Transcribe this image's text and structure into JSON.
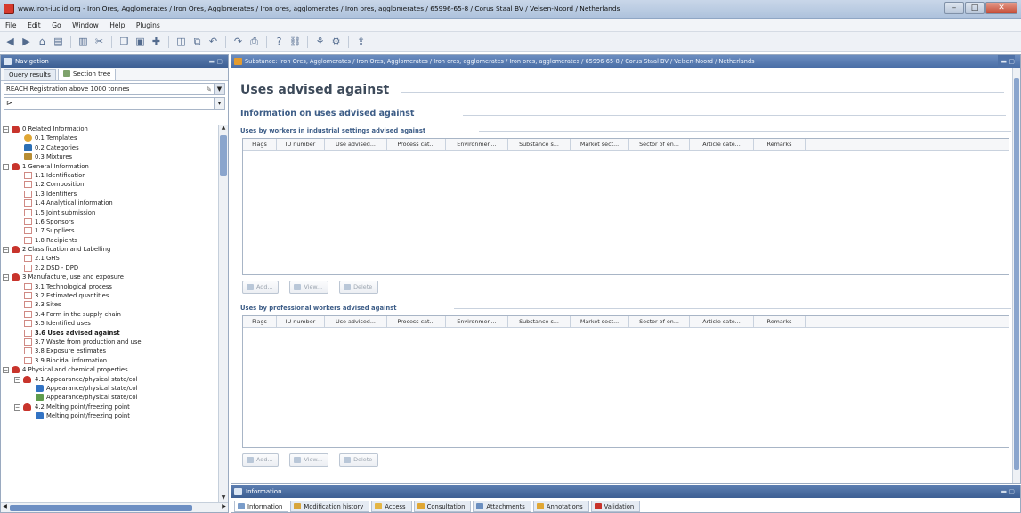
{
  "window": {
    "title": "www.iron-iuclid.org - Iron Ores, Agglomerates / Iron Ores, Agglomerates / Iron ores, agglomerates  / Iron ores, agglomerates  / 65996-65-8 / Corus Staal BV / Velsen-Noord / Netherlands"
  },
  "menu": [
    "File",
    "Edit",
    "Go",
    "Window",
    "Help",
    "Plugins"
  ],
  "toolbar": {
    "icons": [
      "back-icon",
      "forward-icon",
      "home-icon",
      "save-icon",
      "save-all-icon",
      "cut-icon",
      "copy-icon",
      "paste-icon",
      "add-icon",
      "new-icon",
      "duplicate-icon",
      "undo-icon",
      "redo-icon",
      "print-icon",
      "help-icon",
      "link-icon",
      "tree-icon",
      "settings-icon",
      "export-icon"
    ]
  },
  "navigation": {
    "title": "Navigation",
    "tabs": [
      "Query results",
      "Section tree"
    ],
    "template": "REACH Registration above 1000 tonnes",
    "tree": [
      {
        "label": "0 Related Information",
        "level": 0,
        "icon": "folder",
        "expander": "−"
      },
      {
        "label": "0.1 Templates",
        "level": 1,
        "icon": "tmpl"
      },
      {
        "label": "0.2 Categories",
        "level": 1,
        "icon": "cat"
      },
      {
        "label": "0.3 Mixtures",
        "level": 1,
        "icon": "mix"
      },
      {
        "label": "1 General Information",
        "level": 0,
        "icon": "folder",
        "expander": "−"
      },
      {
        "label": "1.1 Identification",
        "level": 1,
        "icon": "doc"
      },
      {
        "label": "1.2 Composition",
        "level": 1,
        "icon": "doc"
      },
      {
        "label": "1.3 Identifiers",
        "level": 1,
        "icon": "doc"
      },
      {
        "label": "1.4 Analytical information",
        "level": 1,
        "icon": "doc"
      },
      {
        "label": "1.5 Joint submission",
        "level": 1,
        "icon": "doc"
      },
      {
        "label": "1.6 Sponsors",
        "level": 1,
        "icon": "doc"
      },
      {
        "label": "1.7 Suppliers",
        "level": 1,
        "icon": "doc"
      },
      {
        "label": "1.8 Recipients",
        "level": 1,
        "icon": "doc"
      },
      {
        "label": "2 Classification and Labelling",
        "level": 0,
        "icon": "folder",
        "expander": "−"
      },
      {
        "label": "2.1 GHS",
        "level": 1,
        "icon": "doc"
      },
      {
        "label": "2.2 DSD - DPD",
        "level": 1,
        "icon": "doc"
      },
      {
        "label": "3 Manufacture, use and exposure",
        "level": 0,
        "icon": "folder",
        "expander": "−"
      },
      {
        "label": "3.1 Technological process",
        "level": 1,
        "icon": "doc"
      },
      {
        "label": "3.2 Estimated quantities",
        "level": 1,
        "icon": "doc"
      },
      {
        "label": "3.3 Sites",
        "level": 1,
        "icon": "doc"
      },
      {
        "label": "3.4 Form in the supply chain",
        "level": 1,
        "icon": "doc"
      },
      {
        "label": "3.5 Identified uses",
        "level": 1,
        "icon": "doc"
      },
      {
        "label": "3.6 Uses advised against",
        "level": 1,
        "icon": "doc",
        "bold": true
      },
      {
        "label": "3.7 Waste from production and use",
        "level": 1,
        "icon": "doc"
      },
      {
        "label": "3.8 Exposure estimates",
        "level": 1,
        "icon": "doc"
      },
      {
        "label": "3.9 Biocidal information",
        "level": 1,
        "icon": "doc"
      },
      {
        "label": "4 Physical and chemical properties",
        "level": 0,
        "icon": "folder",
        "expander": "−"
      },
      {
        "label": "4.1 Appearance/physical state/col",
        "level": 1,
        "icon": "folder",
        "expander": "−"
      },
      {
        "label": "Appearance/physical state/col",
        "level": 2,
        "icon": "blue"
      },
      {
        "label": "Appearance/physical state/col",
        "level": 2,
        "icon": "green"
      },
      {
        "label": "4.2 Melting point/freezing point",
        "level": 1,
        "icon": "folder",
        "expander": "−"
      },
      {
        "label": "Melting point/freezing point",
        "level": 2,
        "icon": "blue"
      }
    ]
  },
  "editor": {
    "header": "Substance: Iron Ores, Agglomerates / Iron Ores, Agglomerates / Iron ores, agglomerates  / Iron ores, agglomerates  / 65996-65-8 / Corus Staal BV / Velsen-Noord / Netherlands",
    "title": "Uses advised against",
    "subtitle": "Information on uses advised against",
    "groups": [
      {
        "label": "Uses by workers in industrial settings advised against",
        "columns": [
          "Flags",
          "IU number",
          "Use advised...",
          "Process cat...",
          "Environmen...",
          "Substance s...",
          "Market sect...",
          "Sector of en...",
          "Article cate...",
          "Remarks"
        ],
        "buttons": [
          "Add...",
          "View...",
          "Delete"
        ]
      },
      {
        "label": "Uses by professional workers advised against",
        "columns": [
          "Flags",
          "IU number",
          "Use advised...",
          "Process cat...",
          "Environmen...",
          "Substance s...",
          "Market sect...",
          "Sector of en...",
          "Article cate...",
          "Remarks"
        ],
        "buttons": [
          "Add...",
          "View...",
          "Delete"
        ]
      }
    ]
  },
  "info": {
    "title": "Information",
    "tabs": [
      "Information",
      "Modification history",
      "Access",
      "Consultation",
      "Attachments",
      "Annotations",
      "Validation"
    ]
  },
  "colors": {
    "panel_header": "#4a6ea6",
    "accent": "#3d5d87",
    "folder": "#c8342c"
  }
}
